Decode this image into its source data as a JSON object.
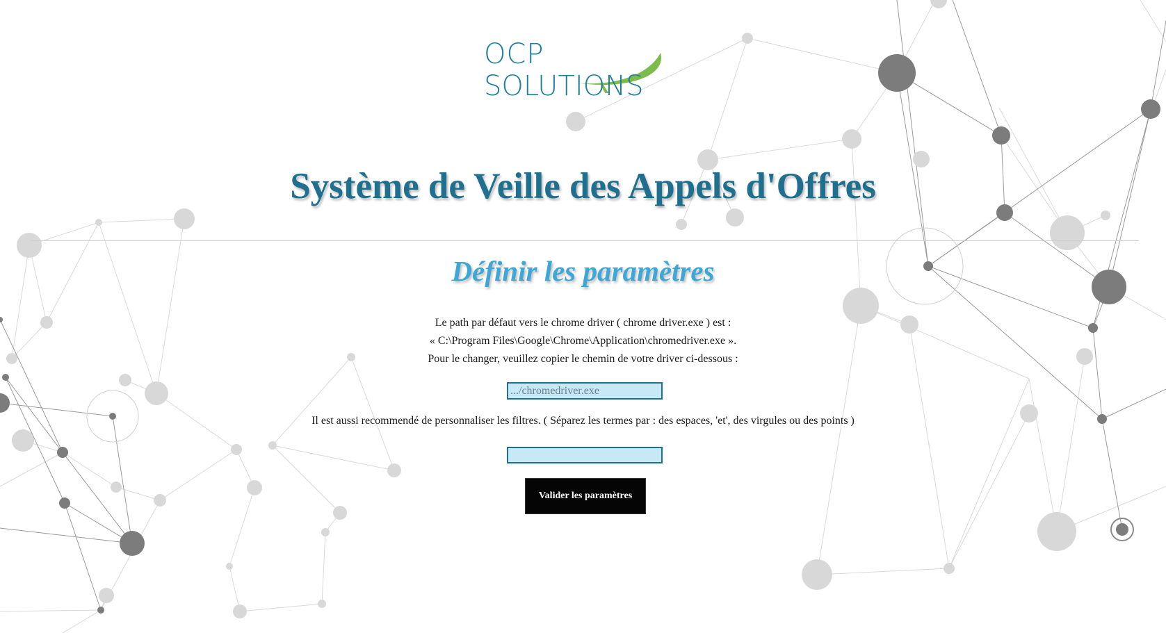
{
  "logo": {
    "line1": "OCP",
    "line2": "SOLUTIONS",
    "primary_color": "#1e7f9c",
    "accent_color": "#7dbb4a"
  },
  "header": {
    "title": "Système de Veille des Appels d'Offres"
  },
  "main": {
    "subtitle": "Définir les paramètres",
    "info_lines": [
      "Le path par défaut vers le chrome driver ( chrome driver.exe ) est :",
      "« C:\\Program Files\\Google\\Chrome\\Application\\chromedriver.exe ».",
      "Pour le changer, veuillez copier le chemin de votre driver ci-dessous :"
    ],
    "driver_input": {
      "placeholder": ".../chromedriver.exe",
      "value": ""
    },
    "filters_text": "Il est aussi recommendé de personnaliser les filtres. ( Séparez les termes par : des espaces, 'et', des virgules ou des points )",
    "filters_input": {
      "placeholder": "",
      "value": ""
    },
    "submit_label": "Valider les paramètres"
  },
  "colors": {
    "title": "#1f6f8f",
    "subtitle": "#3ea7d6",
    "input_bg": "#c7e9f5",
    "button_bg": "#050505"
  }
}
